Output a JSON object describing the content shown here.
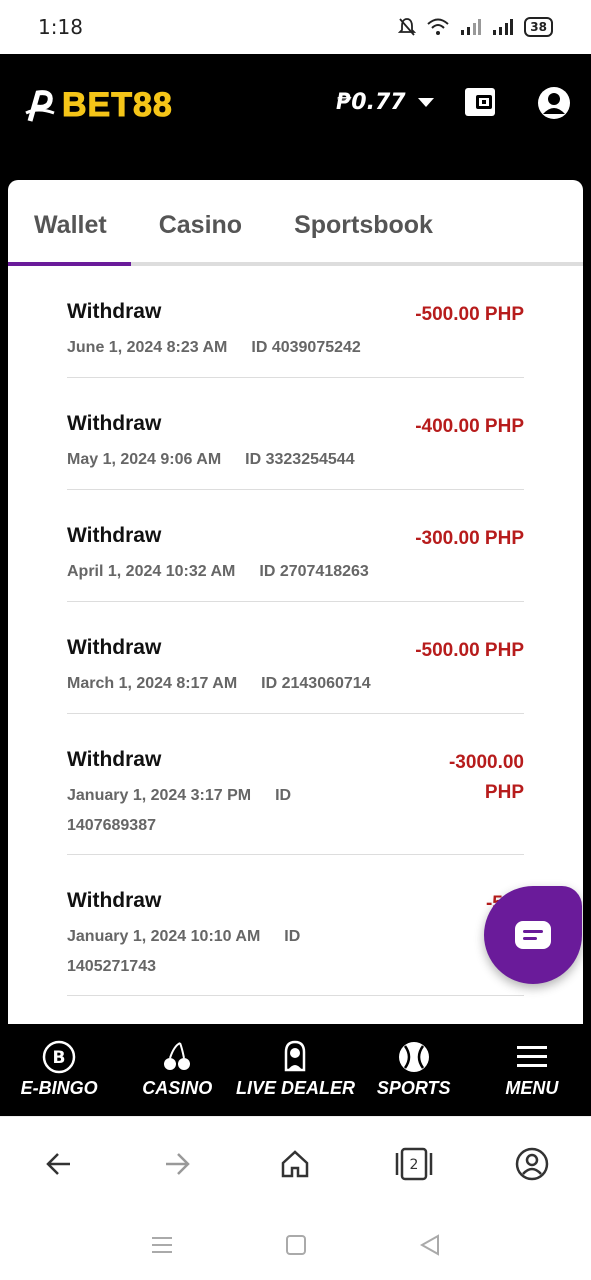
{
  "status": {
    "time": "1:18",
    "battery": "38"
  },
  "header": {
    "logo_text": "BET88",
    "balance": "₱0.77"
  },
  "tabs": [
    {
      "label": "Wallet"
    },
    {
      "label": "Casino"
    },
    {
      "label": "Sportsbook"
    }
  ],
  "transactions": [
    {
      "title": "Withdraw",
      "date": "June 1, 2024 8:23 AM",
      "id": "ID 4039075242",
      "amount": "-500.00 PHP"
    },
    {
      "title": "Withdraw",
      "date": "May 1, 2024 9:06 AM",
      "id": "ID 3323254544",
      "amount": "-400.00 PHP"
    },
    {
      "title": "Withdraw",
      "date": "April 1, 2024 10:32 AM",
      "id": "ID 2707418263",
      "amount": "-300.00 PHP"
    },
    {
      "title": "Withdraw",
      "date": "March 1, 2024 8:17 AM",
      "id": "ID 2143060714",
      "amount": "-500.00 PHP"
    },
    {
      "title": "Withdraw",
      "date": "January 1, 2024 3:17 PM",
      "id_prefix": "ID",
      "id_number": "1407689387",
      "amount_line1": "-3000.00",
      "amount_line2": "PHP"
    },
    {
      "title": "Withdraw",
      "date": "January 1, 2024 10:10 AM",
      "id_prefix": "ID",
      "id_number": "1405271743",
      "amount_partial": "-500"
    }
  ],
  "bottom_nav": [
    {
      "label": "E-BINGO",
      "icon": "bingo-ball-icon"
    },
    {
      "label": "CASINO",
      "icon": "cherry-icon"
    },
    {
      "label": "LIVE DEALER",
      "icon": "dealer-icon"
    },
    {
      "label": "SPORTS",
      "icon": "ball-icon"
    },
    {
      "label": "MENU",
      "icon": "hamburger-icon"
    }
  ],
  "browser": {
    "tab_count": "2"
  },
  "colors": {
    "accent": "#6a1b9a",
    "amount": "#b71c1c",
    "logo": "#f5c518"
  }
}
